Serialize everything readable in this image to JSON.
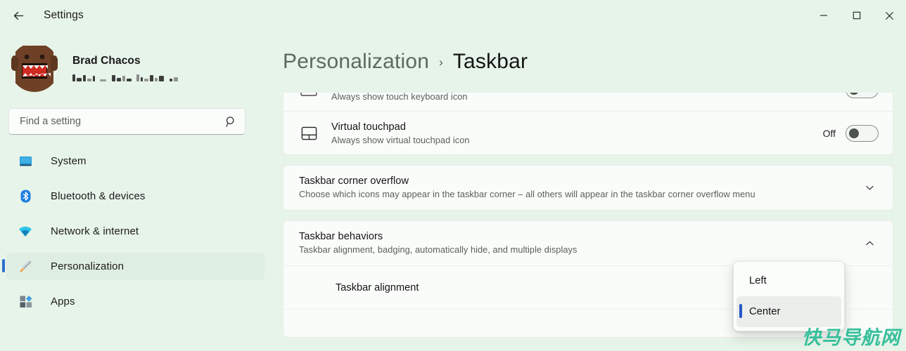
{
  "window": {
    "title": "Settings",
    "back_icon": "back-arrow-icon",
    "minimize_icon": "minimize-icon",
    "maximize_icon": "maximize-icon",
    "close_icon": "close-icon"
  },
  "account": {
    "name": "Brad Chacos",
    "email_redacted": "███ █ ███ ████ ██",
    "avatar_alt": "domo-avatar"
  },
  "search": {
    "placeholder": "Find a setting",
    "value": "",
    "icon": "search-icon"
  },
  "sidebar": {
    "items": [
      {
        "label": "System",
        "icon": "monitor-icon",
        "selected": false
      },
      {
        "label": "Bluetooth & devices",
        "icon": "bluetooth-icon",
        "selected": false
      },
      {
        "label": "Network & internet",
        "icon": "wifi-icon",
        "selected": false
      },
      {
        "label": "Personalization",
        "icon": "paintbrush-icon",
        "selected": true
      },
      {
        "label": "Apps",
        "icon": "apps-icon",
        "selected": false
      }
    ]
  },
  "breadcrumb": {
    "parent": "Personalization",
    "separator": "›",
    "current": "Taskbar"
  },
  "content": {
    "card_system_tray": {
      "rows": [
        {
          "icon": "touch-keyboard-icon",
          "title": "",
          "subtitle": "Always show touch keyboard icon",
          "toggle_state": "",
          "clipped": true
        },
        {
          "icon": "touchpad-icon",
          "title": "Virtual touchpad",
          "subtitle": "Always show virtual touchpad icon",
          "toggle_state": "Off",
          "clipped": false
        }
      ]
    },
    "card_corner_overflow": {
      "title": "Taskbar corner overflow",
      "subtitle": "Choose which icons may appear in the taskbar corner – all others will appear in the taskbar corner overflow menu",
      "chevron": "chevron-down-icon",
      "expanded": false
    },
    "card_behaviors": {
      "title": "Taskbar behaviors",
      "subtitle": "Taskbar alignment, badging, automatically hide, and multiple displays",
      "chevron": "chevron-up-icon",
      "expanded": true,
      "subrows": [
        {
          "label": "Taskbar alignment",
          "value": "Center"
        }
      ]
    }
  },
  "dropdown": {
    "open": true,
    "options": [
      {
        "label": "Left",
        "selected": false
      },
      {
        "label": "Center",
        "selected": true
      }
    ]
  },
  "watermark": {
    "text": "快马导航网",
    "color": "#36bf9a"
  },
  "colors": {
    "page_background": "#e7f4e9",
    "card_background": "#fafcfa",
    "accent_selected": "#2d6fd0",
    "text_primary": "#141414",
    "text_secondary": "#5a5f5a"
  }
}
